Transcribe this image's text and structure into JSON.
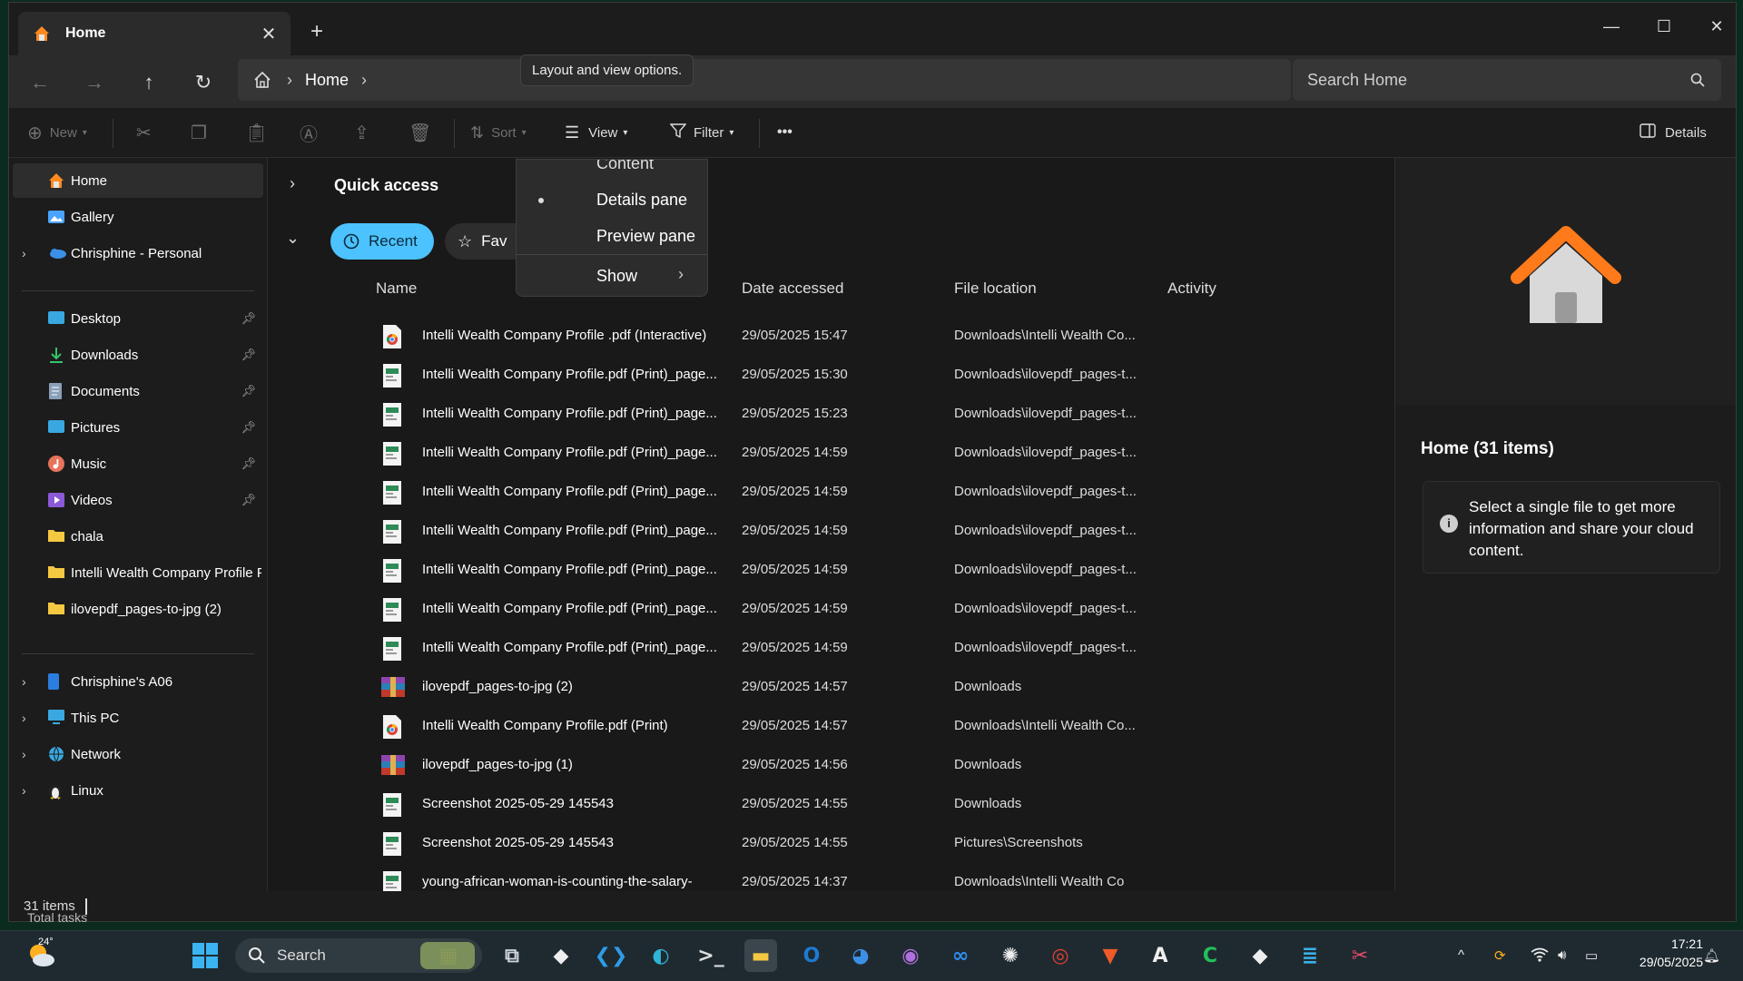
{
  "window": {
    "tab_title": "Home",
    "tab_close": "✕",
    "new_tab": "+",
    "controls": {
      "minimize": "—",
      "maximize": "☐",
      "close": "✕"
    }
  },
  "address": {
    "crumb": "Home",
    "search_placeholder": "Search Home",
    "tooltip": "Layout and view options."
  },
  "commands": {
    "new": "New",
    "sort": "Sort",
    "view": "View",
    "filter": "Filter",
    "more": "•••",
    "details": "Details"
  },
  "sidebar": {
    "top": [
      {
        "label": "Home",
        "icon": "home-icon",
        "color": "#ff8a1f"
      },
      {
        "label": "Gallery",
        "icon": "gallery-icon",
        "color": "#4aa3ff"
      },
      {
        "label": "Chrisphine - Personal",
        "icon": "cloud-icon",
        "color": "#3b8fe6"
      }
    ],
    "pinned": [
      {
        "label": "Desktop",
        "icon": "desktop-icon",
        "color": "#3aa8e0"
      },
      {
        "label": "Downloads",
        "icon": "download-icon",
        "color": "#35c46a"
      },
      {
        "label": "Documents",
        "icon": "document-icon",
        "color": "#8aa0b8"
      },
      {
        "label": "Pictures",
        "icon": "pictures-icon",
        "color": "#3aa8e0"
      },
      {
        "label": "Music",
        "icon": "music-icon",
        "color": "#e8735b"
      },
      {
        "label": "Videos",
        "icon": "videos-icon",
        "color": "#8c5ad8"
      },
      {
        "label": "chala",
        "icon": "folder-icon",
        "color": "#f5c842"
      },
      {
        "label": "Intelli Wealth Company Profile Fe",
        "icon": "folder-icon",
        "color": "#f5c842"
      },
      {
        "label": "ilovepdf_pages-to-jpg (2)",
        "icon": "folder-icon",
        "color": "#f5c842"
      }
    ],
    "bottom": [
      {
        "label": "Chrisphine's A06",
        "icon": "phone-icon",
        "color": "#2b7de0"
      },
      {
        "label": "This PC",
        "icon": "pc-icon",
        "color": "#3aa8e0"
      },
      {
        "label": "Network",
        "icon": "network-icon",
        "color": "#3aa8e0"
      },
      {
        "label": "Linux",
        "icon": "linux-icon",
        "color": "#f0c020"
      }
    ]
  },
  "main": {
    "quick_access": "Quick access",
    "pills": {
      "recent": "Recent",
      "favorites": "Fav"
    },
    "columns": {
      "name": "Name",
      "date": "Date accessed",
      "location": "File location",
      "activity": "Activity"
    },
    "files": [
      {
        "name": "Intelli Wealth Company Profile .pdf (Interactive)",
        "date": "29/05/2025 15:47",
        "location": "Downloads\\Intelli Wealth Co...",
        "icon": "chrome-pdf-icon"
      },
      {
        "name": "Intelli Wealth Company Profile.pdf (Print)_page...",
        "date": "29/05/2025 15:30",
        "location": "Downloads\\ilovepdf_pages-t...",
        "icon": "image-thumb-icon"
      },
      {
        "name": "Intelli Wealth Company Profile.pdf (Print)_page...",
        "date": "29/05/2025 15:23",
        "location": "Downloads\\ilovepdf_pages-t...",
        "icon": "image-thumb-icon"
      },
      {
        "name": "Intelli Wealth Company Profile.pdf (Print)_page...",
        "date": "29/05/2025 14:59",
        "location": "Downloads\\ilovepdf_pages-t...",
        "icon": "image-thumb-icon"
      },
      {
        "name": "Intelli Wealth Company Profile.pdf (Print)_page...",
        "date": "29/05/2025 14:59",
        "location": "Downloads\\ilovepdf_pages-t...",
        "icon": "image-thumb-icon"
      },
      {
        "name": "Intelli Wealth Company Profile.pdf (Print)_page...",
        "date": "29/05/2025 14:59",
        "location": "Downloads\\ilovepdf_pages-t...",
        "icon": "image-thumb-icon"
      },
      {
        "name": "Intelli Wealth Company Profile.pdf (Print)_page...",
        "date": "29/05/2025 14:59",
        "location": "Downloads\\ilovepdf_pages-t...",
        "icon": "image-thumb-icon"
      },
      {
        "name": "Intelli Wealth Company Profile.pdf (Print)_page...",
        "date": "29/05/2025 14:59",
        "location": "Downloads\\ilovepdf_pages-t...",
        "icon": "image-thumb-icon"
      },
      {
        "name": "Intelli Wealth Company Profile.pdf (Print)_page...",
        "date": "29/05/2025 14:59",
        "location": "Downloads\\ilovepdf_pages-t...",
        "icon": "image-thumb-icon"
      },
      {
        "name": "ilovepdf_pages-to-jpg (2)",
        "date": "29/05/2025 14:57",
        "location": "Downloads",
        "icon": "archive-icon"
      },
      {
        "name": "Intelli Wealth Company Profile.pdf (Print)",
        "date": "29/05/2025 14:57",
        "location": "Downloads\\Intelli Wealth Co...",
        "icon": "chrome-pdf-icon"
      },
      {
        "name": "ilovepdf_pages-to-jpg (1)",
        "date": "29/05/2025 14:56",
        "location": "Downloads",
        "icon": "archive-icon"
      },
      {
        "name": "Screenshot 2025-05-29 145543",
        "date": "29/05/2025 14:55",
        "location": "Downloads",
        "icon": "image-thumb-icon"
      },
      {
        "name": "Screenshot 2025-05-29 145543",
        "date": "29/05/2025 14:55",
        "location": "Pictures\\Screenshots",
        "icon": "image-thumb-icon"
      },
      {
        "name": "young-african-woman-is-counting-the-salary-",
        "date": "29/05/2025 14:37",
        "location": "Downloads\\Intelli Wealth Co",
        "icon": "image-thumb-icon"
      }
    ]
  },
  "view_menu": {
    "content": "Content",
    "details_pane": "Details pane",
    "preview_pane": "Preview pane",
    "show": "Show"
  },
  "details": {
    "title": "Home (31 items)",
    "info": "Select a single file to get more information and share your cloud content."
  },
  "status": {
    "count": "31 items",
    "behind_text": "Total tasks"
  },
  "taskbar": {
    "temperature": "24°",
    "search": "Search",
    "time": "17:21",
    "date": "29/05/2025",
    "apps": [
      "start-icon",
      "search",
      "widgets-icon",
      "task-view-icon",
      "dark-app-icon",
      "vscode-icon",
      "edge-icon",
      "terminal-icon",
      "file-explorer-icon",
      "outlook-icon",
      "thunderbird-icon",
      "github-icon",
      "meta-icon",
      "chatgpt-icon",
      "chrome-icon",
      "brave-icon",
      "font-app-icon",
      "green-app-icon",
      "dark-app-icon-2",
      "notepad-icon",
      "snipping-icon"
    ]
  },
  "colors": {
    "accent": "#4cc2ff",
    "window_bg": "#191919",
    "folder": "#f5c842"
  }
}
